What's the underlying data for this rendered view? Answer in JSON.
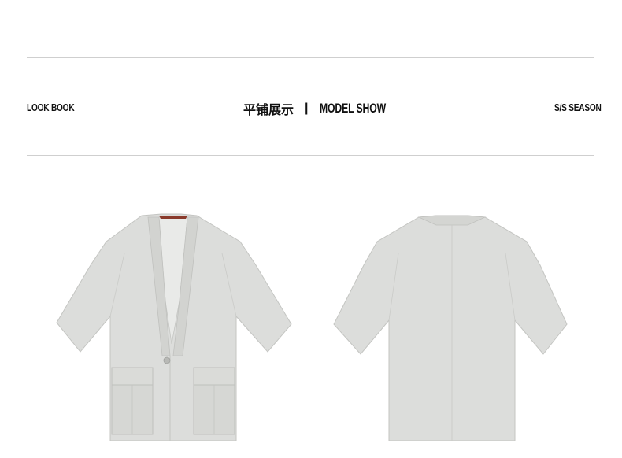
{
  "header": {
    "left_label": "LOOK BOOK",
    "title_cn": "平铺展示",
    "separator": "|",
    "title_en": "MODEL SHOW",
    "right_label": "S/S SEASON"
  },
  "colors": {
    "fabric": "#d9dad8",
    "fabric_shadow": "#c9cac7",
    "rule": "#cfcfcf",
    "collar_tag": "#8a3a2c"
  },
  "products": {
    "front_view": "kimono-shirt-front",
    "back_view": "kimono-shirt-back"
  }
}
